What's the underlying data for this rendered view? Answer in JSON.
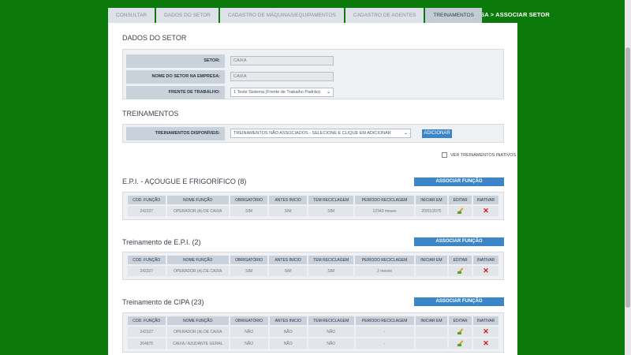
{
  "breadcrumb": "EMPRESA > ASSOCIAR SETOR",
  "tabs": [
    {
      "label": "CONSULTAR"
    },
    {
      "label": "DADOS DO SETOR"
    },
    {
      "label": "CADASTRO DE MÁQUINAS/EQUIPAMENTOS"
    },
    {
      "label": "CADASTRO DE AGENTES"
    },
    {
      "label": "TREINAMENTOS"
    }
  ],
  "setor": {
    "title": "DADOS DO SETOR",
    "setor_label": "SETOR:",
    "setor_value": "CAIXA",
    "nome_label": "NOME DO SETOR NA EMPRESA:",
    "nome_value": "CAIXA",
    "frente_label": "FRENTE DE TRABALHO:",
    "frente_value": "1 Teste Sistema (Frente de Trabalho Padrão)"
  },
  "treinamentos": {
    "title": "TREINAMENTOS",
    "disp_label": "TREINAMENTOS DISPONÍVEIS:",
    "disp_value": "TREINAMENTOS NÃO ASSOCIADOS - SELECIONE E CLIQUE EM ADICIONAR",
    "add_label": "ADICIONAR",
    "inativos_label": "VER TREINAMENTOS INATIVOS"
  },
  "assoc_label": "ASSOCIAR FUNÇÃO",
  "columns": [
    "COD. FUNÇÃO",
    "NOME FUNÇÃO",
    "OBRIGATÓRIO",
    "ANTES INICIO",
    "TEM RECICLAGEM",
    "PERÍODO RECICLAGEM",
    "INICIAR EM",
    "EDITAR",
    "INATIVAR"
  ],
  "groups": [
    {
      "title": "E.P.I. - AÇOUGUE E FRIGORÍFICO (8)",
      "rows": [
        {
          "cod": "242327",
          "nome": "OPERADOR (A) DE CAIXA",
          "obrig": "SIM",
          "antes": "SIM",
          "recic": "SIM",
          "periodo": "12343 meses",
          "iniciar": "20/01/2075"
        }
      ]
    },
    {
      "title": "Treinamento de E.P.I. (2)",
      "rows": [
        {
          "cod": "242327",
          "nome": "OPERADOR (A) DE CAIXA",
          "obrig": "SIM",
          "antes": "SIM",
          "recic": "SIM",
          "periodo": "2 meses",
          "iniciar": ""
        }
      ]
    },
    {
      "title": "Treinamento de CIPA (23)",
      "rows": [
        {
          "cod": "242327",
          "nome": "OPERADOR (A) DE CAIXA",
          "obrig": "NÃO",
          "antes": "NÃO",
          "recic": "NÃO",
          "periodo": "-",
          "iniciar": ""
        },
        {
          "cod": "264875",
          "nome": "CAIXA / AJUDANTE GERAL",
          "obrig": "NÃO",
          "antes": "NÃO",
          "recic": "NÃO",
          "periodo": "-",
          "iniciar": ""
        }
      ]
    }
  ]
}
